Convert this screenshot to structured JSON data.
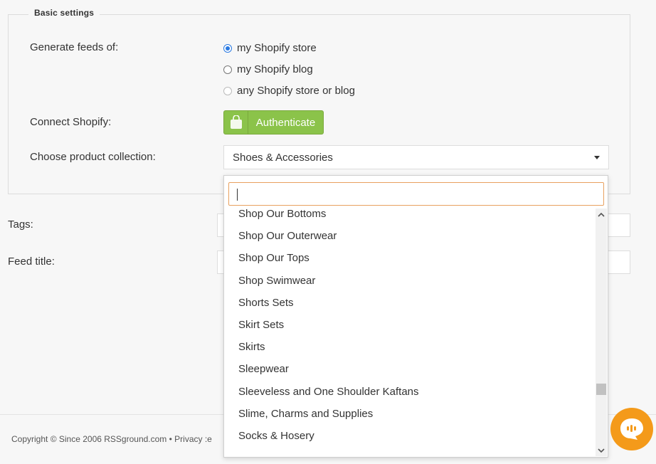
{
  "fieldset": {
    "legend": "Basic settings"
  },
  "generate": {
    "label": "Generate feeds of:",
    "options": [
      {
        "label": "my Shopify store",
        "checked": true
      },
      {
        "label": "my Shopify blog",
        "checked": false
      },
      {
        "label": "any Shopify store or blog",
        "checked": false
      }
    ]
  },
  "connect": {
    "label": "Connect Shopify:",
    "button_label": "Authenticate",
    "icon": "shopping-bag-icon"
  },
  "collection": {
    "label": "Choose product collection:",
    "selected": "Shoes & Accessories",
    "search_value": "",
    "items": [
      "Shop Our Bottoms",
      "Shop Our Outerwear",
      "Shop Our Tops",
      "Shop Swimwear",
      "Shorts Sets",
      "Skirt Sets",
      "Skirts",
      "Sleepwear",
      "Sleeveless and One Shoulder Kaftans",
      "Slime, Charms and Supplies",
      "Socks & Hosery"
    ]
  },
  "tags": {
    "label": "Tags:"
  },
  "feed_title": {
    "label": "Feed title:"
  },
  "footer": {
    "text": "Copyright © Since 2006 RSSground.com • Privacy :e"
  },
  "colors": {
    "accent": "#2a7ae2",
    "button_green": "#8bc34a",
    "chat_orange": "#f49a1a",
    "search_border": "#e8a15f"
  }
}
